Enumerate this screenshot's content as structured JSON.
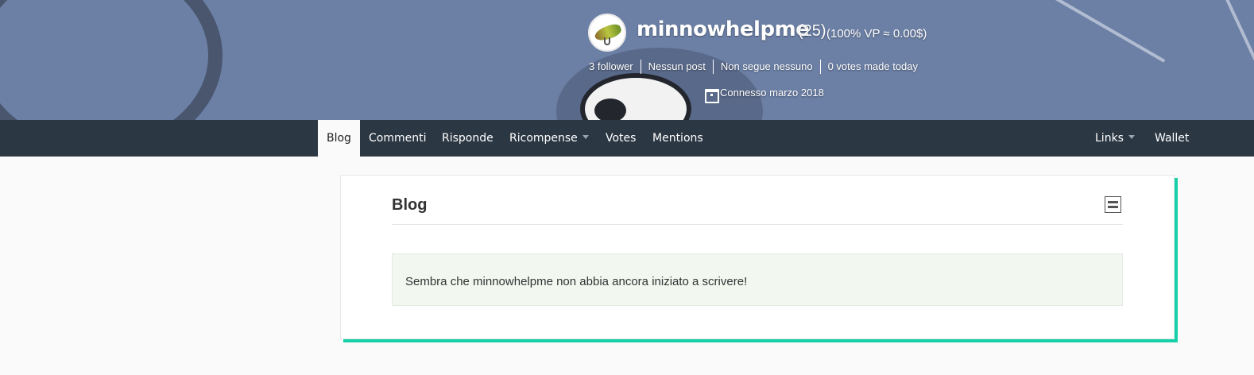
{
  "profile": {
    "username": "minnowhelpme",
    "reputation": "(25)",
    "voting_power": "(100% VP ≈ 0.00$)",
    "stats": [
      "3 follower",
      "Nessun post",
      "Non segue nessuno",
      "0 votes made today"
    ],
    "joined": "Connesso marzo 2018"
  },
  "nav": {
    "left": [
      {
        "label": "Blog",
        "active": true,
        "dropdown": false
      },
      {
        "label": "Commenti",
        "active": false,
        "dropdown": false
      },
      {
        "label": "Risponde",
        "active": false,
        "dropdown": false
      },
      {
        "label": "Ricompense",
        "active": false,
        "dropdown": true
      },
      {
        "label": "Votes",
        "active": false,
        "dropdown": false
      },
      {
        "label": "Mentions",
        "active": false,
        "dropdown": false
      }
    ],
    "right": [
      {
        "label": "Links",
        "dropdown": true
      },
      {
        "label": "Wallet",
        "dropdown": false
      }
    ]
  },
  "blog": {
    "title": "Blog",
    "empty_message": "Sembra che minnowhelpme non abbia ancora iniziato a scrivere!"
  },
  "colors": {
    "cover": "#6c80a6",
    "navbar": "#2b3743",
    "card_accent": "#16d0a8",
    "alert_bg": "#f2f7f0"
  }
}
